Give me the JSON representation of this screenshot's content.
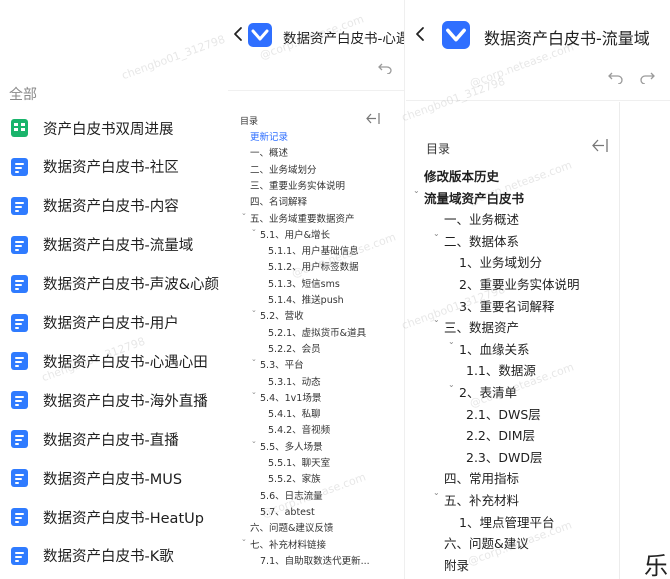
{
  "list_panel": {
    "heading": "全部",
    "items": [
      {
        "label": "资产白皮书双周进展",
        "icon": "sheet-icon"
      },
      {
        "label": "数据资产白皮书-社区",
        "icon": "doc-icon"
      },
      {
        "label": "数据资产白皮书-内容",
        "icon": "doc-icon"
      },
      {
        "label": "数据资产白皮书-流量域",
        "icon": "doc-icon"
      },
      {
        "label": "数据资产白皮书-声波&心颜",
        "icon": "doc-icon"
      },
      {
        "label": "数据资产白皮书-用户",
        "icon": "doc-icon"
      },
      {
        "label": "数据资产白皮书-心遇心田",
        "icon": "doc-icon"
      },
      {
        "label": "数据资产白皮书-海外直播",
        "icon": "doc-icon"
      },
      {
        "label": "数据资产白皮书-直播",
        "icon": "doc-icon"
      },
      {
        "label": "数据资产白皮书-MUS",
        "icon": "doc-icon"
      },
      {
        "label": "数据资产白皮书-HeatUp",
        "icon": "doc-icon"
      },
      {
        "label": "数据资产白皮书-K歌",
        "icon": "doc-icon"
      }
    ]
  },
  "mid_panel": {
    "title": "数据资产白皮书-心遇",
    "toc_label": "目录",
    "items": [
      {
        "label": "更新记录",
        "level": 0,
        "caret": false,
        "link": true
      },
      {
        "label": "一、概述",
        "level": 0,
        "caret": false
      },
      {
        "label": "二、业务域划分",
        "level": 0,
        "caret": false
      },
      {
        "label": "三、重要业务实体说明",
        "level": 0,
        "caret": false
      },
      {
        "label": "四、名词解释",
        "level": 0,
        "caret": false
      },
      {
        "label": "五、业务域重要数据资产",
        "level": 0,
        "caret": true
      },
      {
        "label": "5.1、用户&增长",
        "level": 1,
        "caret": true
      },
      {
        "label": "5.1.1、用户基础信息",
        "level": 2,
        "caret": false
      },
      {
        "label": "5.1.2、用户标签数据",
        "level": 2,
        "caret": false
      },
      {
        "label": "5.1.3、短信sms",
        "level": 2,
        "caret": false
      },
      {
        "label": "5.1.4、推送push",
        "level": 2,
        "caret": false
      },
      {
        "label": "5.2、营收",
        "level": 1,
        "caret": true
      },
      {
        "label": "5.2.1、虚拟货币&道具",
        "level": 2,
        "caret": false
      },
      {
        "label": "5.2.2、会员",
        "level": 2,
        "caret": false
      },
      {
        "label": "5.3、平台",
        "level": 1,
        "caret": true
      },
      {
        "label": "5.3.1、动态",
        "level": 2,
        "caret": false
      },
      {
        "label": "5.4、1v1场景",
        "level": 1,
        "caret": true
      },
      {
        "label": "5.4.1、私聊",
        "level": 2,
        "caret": false
      },
      {
        "label": "5.4.2、音视频",
        "level": 2,
        "caret": false
      },
      {
        "label": "5.5、多人场景",
        "level": 1,
        "caret": true
      },
      {
        "label": "5.5.1、聊天室",
        "level": 2,
        "caret": false
      },
      {
        "label": "5.5.2、家族",
        "level": 2,
        "caret": false
      },
      {
        "label": "5.6、日志流量",
        "level": 1,
        "caret": false
      },
      {
        "label": "5.7、abtest",
        "level": 1,
        "caret": false
      },
      {
        "label": "六、问题&建议反馈",
        "level": 0,
        "caret": false
      },
      {
        "label": "七、补充材料链接",
        "level": 0,
        "caret": true
      },
      {
        "label": "7.1、自助取数迭代更新...",
        "level": 1,
        "caret": false
      }
    ]
  },
  "right_panel": {
    "title": "数据资产白皮书-流量域",
    "toc_label": "目录",
    "cut_glyph": "乐",
    "items": [
      {
        "label": "修改版本历史",
        "level": 0,
        "caret": false,
        "bold": true
      },
      {
        "label": "流量域资产白皮书",
        "level": 0,
        "caret": true,
        "bold": true
      },
      {
        "label": "一、业务概述",
        "level": 1,
        "caret": false
      },
      {
        "label": "二、数据体系",
        "level": 1,
        "caret": true
      },
      {
        "label": "1、业务域划分",
        "level": 2,
        "caret": false
      },
      {
        "label": "2、重要业务实体说明",
        "level": 2,
        "caret": false
      },
      {
        "label": "3、重要名词解释",
        "level": 2,
        "caret": false
      },
      {
        "label": "三、数据资产",
        "level": 1,
        "caret": true
      },
      {
        "label": "1、血缘关系",
        "level": 2,
        "caret": true
      },
      {
        "label": "1.1、数据源",
        "level": 3,
        "caret": false
      },
      {
        "label": "2、表清单",
        "level": 2,
        "caret": true
      },
      {
        "label": "2.1、DWS层",
        "level": 3,
        "caret": false
      },
      {
        "label": "2.2、DIM层",
        "level": 3,
        "caret": false
      },
      {
        "label": "2.3、DWD层",
        "level": 3,
        "caret": false
      },
      {
        "label": "四、常用指标",
        "level": 1,
        "caret": false
      },
      {
        "label": "五、补充材料",
        "level": 1,
        "caret": true
      },
      {
        "label": "1、埋点管理平台",
        "level": 2,
        "caret": false
      },
      {
        "label": "六、问题&建议",
        "level": 1,
        "caret": false
      },
      {
        "label": "附录",
        "level": 1,
        "caret": false
      }
    ]
  },
  "watermark": {
    "text_user": "chengbo01_312798",
    "text_domain": "@corp.netease.com"
  },
  "colors": {
    "doc_icon": "#2f7bff",
    "sheet_icon": "#19b46b",
    "link": "#2f6fff"
  }
}
